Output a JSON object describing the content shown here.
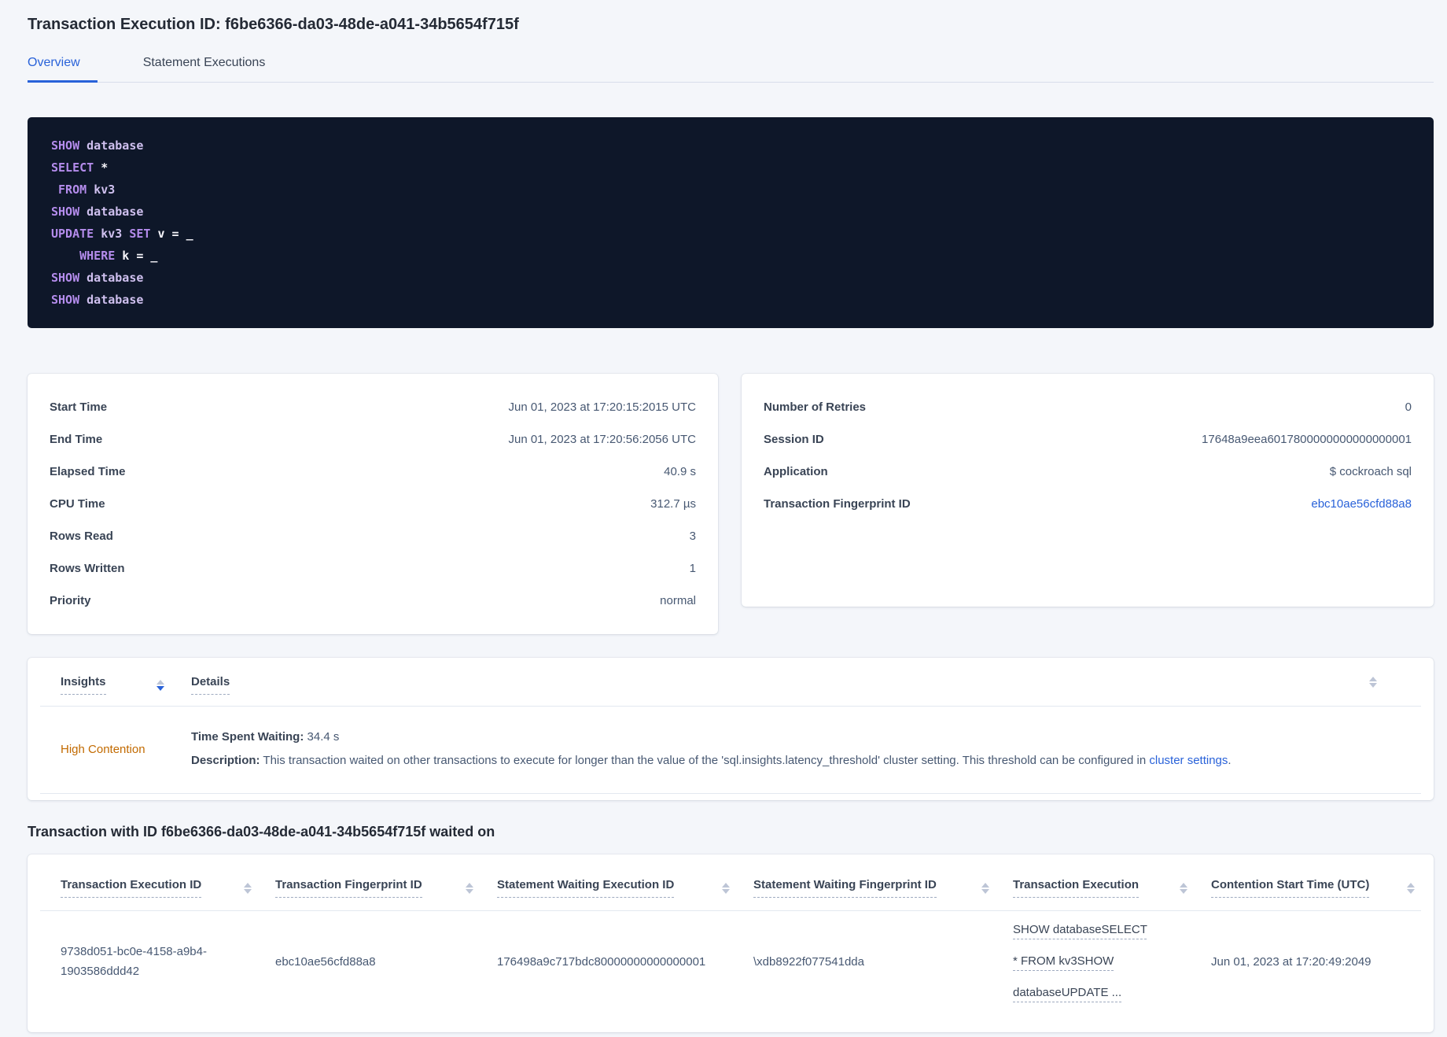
{
  "page": {
    "title": "Transaction Execution ID: f6be6366-da03-48de-a041-34b5654f715f"
  },
  "tabs": [
    {
      "label": "Overview",
      "active": true
    },
    {
      "label": "Statement Executions",
      "active": false
    }
  ],
  "sql_box": {
    "lines": [
      [
        {
          "t": "kw",
          "v": "SHOW"
        },
        {
          "t": "pl",
          "v": " "
        },
        {
          "t": "id",
          "v": "database"
        }
      ],
      [
        {
          "t": "kw",
          "v": "SELECT"
        },
        {
          "t": "pl",
          "v": " *"
        }
      ],
      [
        {
          "t": "pl",
          "v": " "
        },
        {
          "t": "kw",
          "v": "FROM"
        },
        {
          "t": "pl",
          "v": " "
        },
        {
          "t": "id",
          "v": "kv3"
        }
      ],
      [
        {
          "t": "kw",
          "v": "SHOW"
        },
        {
          "t": "pl",
          "v": " "
        },
        {
          "t": "id",
          "v": "database"
        }
      ],
      [
        {
          "t": "kw",
          "v": "UPDATE"
        },
        {
          "t": "pl",
          "v": " "
        },
        {
          "t": "id",
          "v": "kv3"
        },
        {
          "t": "pl",
          "v": " "
        },
        {
          "t": "kw",
          "v": "SET"
        },
        {
          "t": "pl",
          "v": " v = _"
        }
      ],
      [
        {
          "t": "pl",
          "v": "    "
        },
        {
          "t": "kw",
          "v": "WHERE"
        },
        {
          "t": "pl",
          "v": " k = _"
        }
      ],
      [
        {
          "t": "kw",
          "v": "SHOW"
        },
        {
          "t": "pl",
          "v": " "
        },
        {
          "t": "id",
          "v": "database"
        }
      ],
      [
        {
          "t": "kw",
          "v": "SHOW"
        },
        {
          "t": "pl",
          "v": " "
        },
        {
          "t": "id",
          "v": "database"
        }
      ]
    ]
  },
  "summary_left": {
    "rows": [
      {
        "label": "Start Time",
        "value": "Jun 01, 2023 at 17:20:15:2015 UTC"
      },
      {
        "label": "End Time",
        "value": "Jun 01, 2023 at 17:20:56:2056 UTC"
      },
      {
        "label": "Elapsed Time",
        "value": "40.9 s"
      },
      {
        "label": "CPU Time",
        "value": "312.7 µs"
      },
      {
        "label": "Rows Read",
        "value": "3"
      },
      {
        "label": "Rows Written",
        "value": "1"
      },
      {
        "label": "Priority",
        "value": "normal"
      }
    ]
  },
  "summary_right": {
    "rows": [
      {
        "label": "Number of Retries",
        "value": "0"
      },
      {
        "label": "Session ID",
        "value": "17648a9eea6017800000000000000001"
      },
      {
        "label": "Application",
        "value": "$ cockroach sql"
      },
      {
        "label": "Transaction Fingerprint ID",
        "value": "ebc10ae56cfd88a8",
        "link": true
      }
    ]
  },
  "insights": {
    "columns": [
      {
        "label": "Insights",
        "sorted_desc": true
      },
      {
        "label": "Details"
      }
    ],
    "row": {
      "insight": "High Contention",
      "waiting_label": "Time Spent Waiting:",
      "waiting_value": " 34.4 s",
      "description_label": "Description:",
      "description_text": " This transaction waited on other transactions to execute for longer than the value of the 'sql.insights.latency_threshold' cluster setting. This threshold can be configured in ",
      "description_link": "cluster settings",
      "description_suffix": "."
    }
  },
  "waited_on": {
    "heading": "Transaction with ID f6be6366-da03-48de-a041-34b5654f715f waited on",
    "columns": [
      "Transaction Execution ID",
      "Transaction Fingerprint ID",
      "Statement Waiting Execution ID",
      "Statement Waiting Fingerprint ID",
      "Transaction Execution",
      "Contention Start Time (UTC)"
    ],
    "rows": [
      {
        "cells": [
          "9738d051-bc0e-4158-a9b4-1903586ddd42",
          "ebc10ae56cfd88a8",
          "176498a9c717bdc80000000000000001",
          "\\xdb8922f077541dda",
          "SHOW databaseSELECT * FROM kv3SHOW databaseUPDATE ...",
          "Jun 01, 2023 at 17:20:49:2049"
        ],
        "link_cell_index": 4
      }
    ]
  },
  "icons": {
    "sort": "up-down-sort-arrows"
  },
  "colors": {
    "accent_blue": "#2962d9",
    "high_contention_orange": "#c26a00",
    "code_background": "#0e1729",
    "code_keyword": "#b48cec",
    "page_background": "#f4f6fa"
  }
}
